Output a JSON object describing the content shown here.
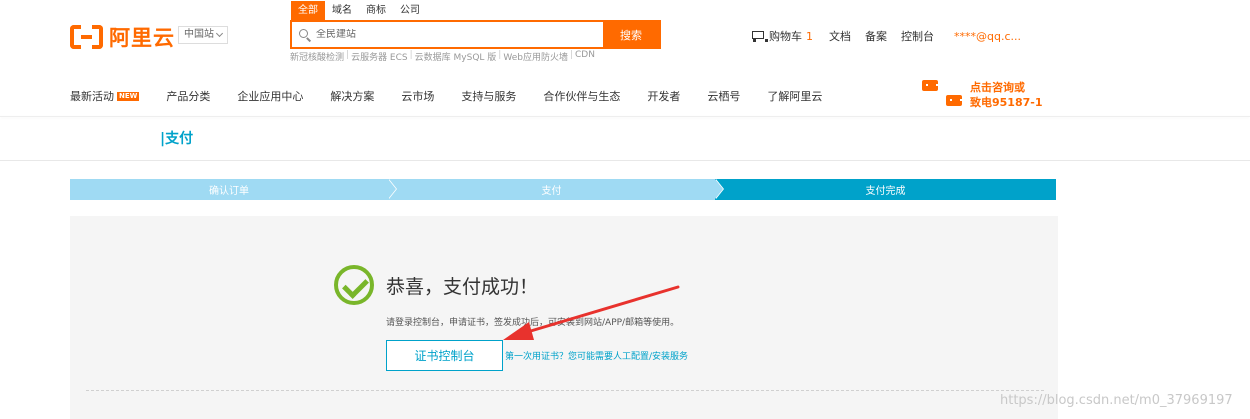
{
  "header": {
    "logo_text": "阿里云",
    "site_switch": "中国站",
    "search": {
      "tabs": [
        "全部",
        "域名",
        "商标",
        "公司"
      ],
      "placeholder": "全民建站",
      "button": "搜索",
      "hot_links": [
        "新冠核酸检测",
        "云服务器 ECS",
        "云数据库 MySQL 版",
        "Web应用防火墙",
        "CDN"
      ]
    },
    "cart_label": "购物车",
    "cart_count": "1",
    "links": [
      "文档",
      "备案",
      "控制台"
    ],
    "user_email": "****@qq.c..."
  },
  "nav": {
    "items": [
      {
        "label": "最新活动",
        "badge": "NEW"
      },
      {
        "label": "产品分类"
      },
      {
        "label": "企业应用中心"
      },
      {
        "label": "解决方案"
      },
      {
        "label": "云市场"
      },
      {
        "label": "支持与服务"
      },
      {
        "label": "合作伙伴与生态"
      },
      {
        "label": "开发者"
      },
      {
        "label": "云栖号"
      },
      {
        "label": "了解阿里云"
      }
    ],
    "consult_line1": "点击咨询或",
    "consult_line2": "致电95187-1"
  },
  "page": {
    "title": "|支付"
  },
  "steps": [
    "确认订单",
    "支付",
    "支付完成"
  ],
  "result": {
    "title": "恭喜，支付成功！",
    "description": "请登录控制台，申请证书，签发成功后，可安装到网站/APP/邮箱等使用。",
    "button": "证书控制台",
    "help_link": "第一次用证书？您可能需要人工配置/安装服务"
  },
  "watermark": "https://blog.csdn.net/m0_37969197",
  "colors": {
    "brand": "#ff6a00",
    "accent": "#00a2ca",
    "success": "#79b62a",
    "step_inactive": "#9fdaf3",
    "annotation_arrow": "#e8322d"
  }
}
